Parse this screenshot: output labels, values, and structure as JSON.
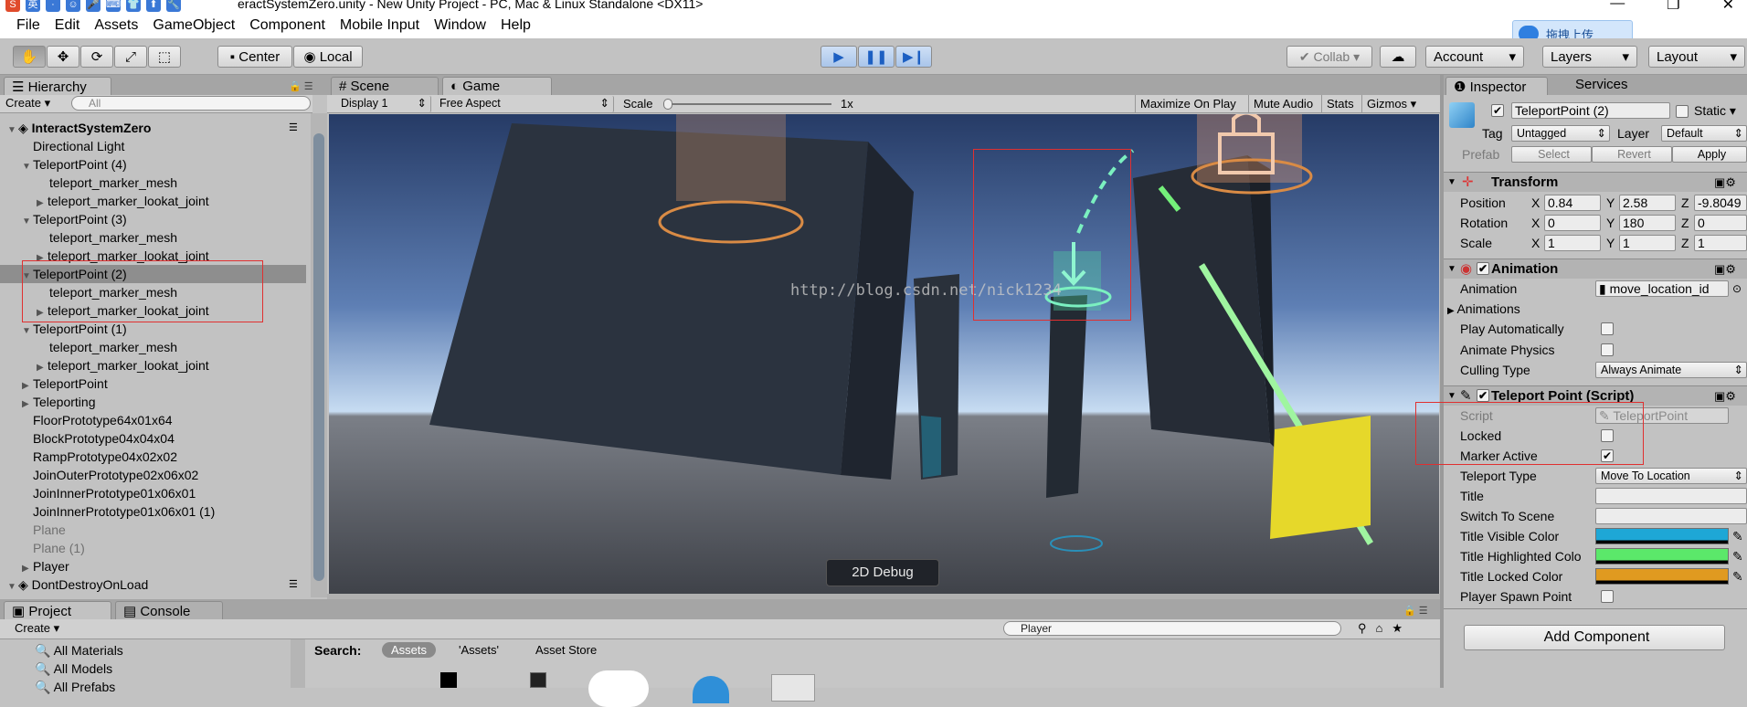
{
  "titlebar": {
    "title": "eractSystemZero.unity - New Unity Project - PC, Mac & Linux Standalone <DX11>",
    "ime_chars": [
      "S",
      "英",
      "·",
      "☺",
      "🎤",
      "⌨",
      "👕",
      "⬆",
      "🔧"
    ],
    "min": "—",
    "max": "❐",
    "close": "✕"
  },
  "cloud_upload": {
    "label": "拖拽上传"
  },
  "menu": [
    "File",
    "Edit",
    "Assets",
    "GameObject",
    "Component",
    "Mobile Input",
    "Window",
    "Help"
  ],
  "toolbar": {
    "tools": [
      "hand-icon",
      "move-icon",
      "rotate-icon",
      "scale-icon",
      "rect-icon"
    ],
    "pivot": "Center",
    "space": "Local",
    "collab": "Collab",
    "account": "Account",
    "layers": "Layers",
    "layout": "Layout"
  },
  "hierarchy": {
    "tab": "Hierarchy",
    "create": "Create",
    "search_placeholder": "All",
    "rows": [
      {
        "label": "InteractSystemZero",
        "indent": 0,
        "arrow": "▼",
        "bold": true,
        "scene": true
      },
      {
        "label": "Directional Light",
        "indent": 1,
        "arrow": ""
      },
      {
        "label": "TeleportPoint (4)",
        "indent": 1,
        "arrow": "▼"
      },
      {
        "label": "teleport_marker_mesh",
        "indent": 2,
        "arrow": ""
      },
      {
        "label": "teleport_marker_lookat_joint",
        "indent": 2,
        "arrow": "▶"
      },
      {
        "label": "TeleportPoint (3)",
        "indent": 1,
        "arrow": "▼"
      },
      {
        "label": "teleport_marker_mesh",
        "indent": 2,
        "arrow": ""
      },
      {
        "label": "teleport_marker_lookat_joint",
        "indent": 2,
        "arrow": "▶"
      },
      {
        "label": "TeleportPoint (2)",
        "indent": 1,
        "arrow": "▼",
        "selected": true
      },
      {
        "label": "teleport_marker_mesh",
        "indent": 2,
        "arrow": ""
      },
      {
        "label": "teleport_marker_lookat_joint",
        "indent": 2,
        "arrow": "▶"
      },
      {
        "label": "TeleportPoint (1)",
        "indent": 1,
        "arrow": "▼"
      },
      {
        "label": "teleport_marker_mesh",
        "indent": 2,
        "arrow": ""
      },
      {
        "label": "teleport_marker_lookat_joint",
        "indent": 2,
        "arrow": "▶"
      },
      {
        "label": "TeleportPoint",
        "indent": 1,
        "arrow": "▶"
      },
      {
        "label": "Teleporting",
        "indent": 1,
        "arrow": "▶"
      },
      {
        "label": "FloorPrototype64x01x64",
        "indent": 1,
        "arrow": ""
      },
      {
        "label": "BlockPrototype04x04x04",
        "indent": 1,
        "arrow": ""
      },
      {
        "label": "RampPrototype04x02x02",
        "indent": 1,
        "arrow": ""
      },
      {
        "label": "JoinOuterPrototype02x06x02",
        "indent": 1,
        "arrow": ""
      },
      {
        "label": "JoinInnerPrototype01x06x01",
        "indent": 1,
        "arrow": ""
      },
      {
        "label": "JoinInnerPrototype01x06x01 (1)",
        "indent": 1,
        "arrow": ""
      },
      {
        "label": "Plane",
        "indent": 1,
        "arrow": "",
        "grey": true
      },
      {
        "label": "Plane (1)",
        "indent": 1,
        "arrow": "",
        "grey": true
      },
      {
        "label": "Player",
        "indent": 1,
        "arrow": "▶"
      },
      {
        "label": "DontDestroyOnLoad",
        "indent": 0,
        "arrow": "▼",
        "scene": true
      }
    ]
  },
  "views": {
    "scene_tab": "Scene",
    "game_tab": "Game",
    "display": "Display 1",
    "aspect": "Free Aspect",
    "scale_label": "Scale",
    "scale_value": "1x",
    "maximize": "Maximize On Play",
    "mute": "Mute Audio",
    "stats": "Stats",
    "gizmos": "Gizmos",
    "debug_button": "2D Debug",
    "watermark": "http://blog.csdn.net/nick1234"
  },
  "project": {
    "tab": "Project",
    "console_tab": "Console",
    "create": "Create",
    "search_value": "Player",
    "search_label": "Search:",
    "scope_assets": "Assets",
    "scope_quoted": "'Assets'",
    "scope_store": "Asset Store",
    "favorites": [
      "All Materials",
      "All Models",
      "All Prefabs"
    ]
  },
  "inspector": {
    "tab": "Inspector",
    "services_tab": "Services",
    "object_name": "TeleportPoint (2)",
    "static_label": "Static",
    "tag_label": "Tag",
    "tag_value": "Untagged",
    "layer_label": "Layer",
    "layer_value": "Default",
    "prefab_label": "Prefab",
    "prefab_select": "Select",
    "prefab_revert": "Revert",
    "prefab_apply": "Apply",
    "transform": {
      "title": "Transform",
      "position": {
        "label": "Position",
        "x": "0.84",
        "y": "2.58",
        "z": "-9.8049"
      },
      "rotation": {
        "label": "Rotation",
        "x": "0",
        "y": "180",
        "z": "0"
      },
      "scale": {
        "label": "Scale",
        "x": "1",
        "y": "1",
        "z": "1"
      }
    },
    "animation": {
      "title": "Animation",
      "animation_label": "Animation",
      "animation_value": "move_location_id",
      "animations_label": "Animations",
      "play_auto_label": "Play Automatically",
      "animate_physics_label": "Animate Physics",
      "culling_label": "Culling Type",
      "culling_value": "Always Animate"
    },
    "teleport": {
      "title": "Teleport Point (Script)",
      "script_label": "Script",
      "script_value": "TeleportPoint",
      "locked_label": "Locked",
      "marker_active_label": "Marker Active",
      "teleport_type_label": "Teleport Type",
      "teleport_type_value": "Move To Location",
      "title_label": "Title",
      "switch_scene_label": "Switch To Scene",
      "title_visible_label": "Title Visible Color",
      "title_highlight_label": "Title Highlighted Colo",
      "title_locked_label": "Title Locked Color",
      "spawn_label": "Player Spawn Point",
      "colors": {
        "visible": "#1ea7d6",
        "highlight": "#5be86a",
        "locked": "#e09a20"
      }
    },
    "add_component": "Add Component"
  },
  "axis_labels": {
    "x": "X",
    "y": "Y",
    "z": "Z"
  },
  "check_mark": "✔"
}
